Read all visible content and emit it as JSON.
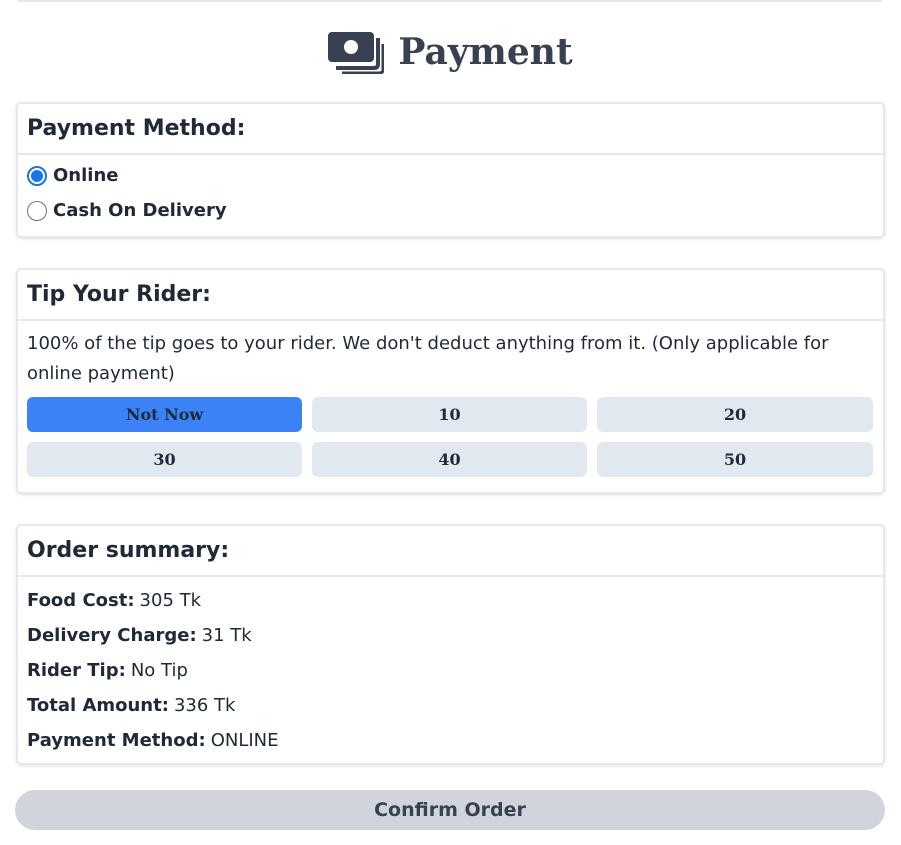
{
  "header": {
    "title": "Payment",
    "icon": "money-bill-icon"
  },
  "payment_method": {
    "title": "Payment Method:",
    "options": [
      {
        "label": "Online",
        "selected": true
      },
      {
        "label": "Cash On Delivery",
        "selected": false
      }
    ]
  },
  "tip": {
    "title": "Tip Your Rider:",
    "description": "100% of the tip goes to your rider. We don't deduct anything from it. (Only applicable for online payment)",
    "options": [
      "Not Now",
      "10",
      "20",
      "30",
      "40",
      "50"
    ],
    "selected": "Not Now",
    "active_color": "#3b82f6"
  },
  "summary": {
    "title": "Order summary:",
    "rows": [
      {
        "label": "Food Cost:",
        "value": "305 Tk"
      },
      {
        "label": "Delivery Charge:",
        "value": "31 Tk"
      },
      {
        "label": "Rider Tip:",
        "value": "No Tip"
      },
      {
        "label": "Total Amount:",
        "value": "336 Tk"
      },
      {
        "label": "Payment Method:",
        "value": "ONLINE"
      }
    ]
  },
  "confirm": {
    "label": "Confirm Order"
  }
}
